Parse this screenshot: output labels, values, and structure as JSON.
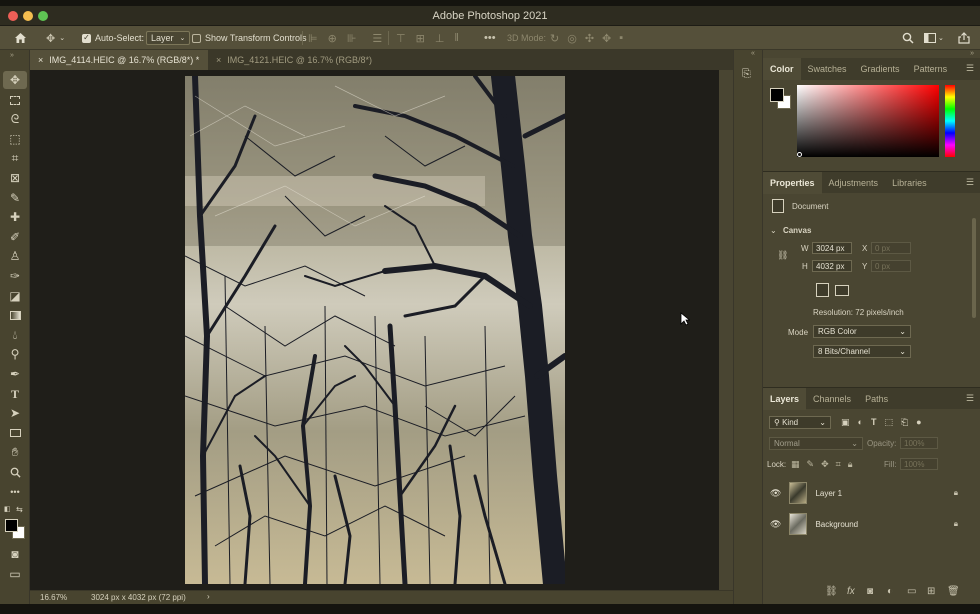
{
  "app": {
    "title": "Adobe Photoshop 2021"
  },
  "options_bar": {
    "auto_select_label": "Auto-Select:",
    "auto_select_checked": true,
    "auto_select_target": "Layer",
    "show_transform_label": "Show Transform Controls",
    "show_transform_checked": false,
    "mode_3d_label": "3D Mode:"
  },
  "tabs": [
    {
      "label": "IMG_4114.HEIC @ 16.7% (RGB/8*) *",
      "active": true
    },
    {
      "label": "IMG_4121.HEIC @ 16.7% (RGB/8*)",
      "active": false
    }
  ],
  "status_bar": {
    "zoom": "16.67%",
    "doc_info": "3024 px x 4032 px (72 ppi)"
  },
  "color_panel": {
    "tabs": [
      "Color",
      "Swatches",
      "Gradients",
      "Patterns"
    ],
    "active_tab": "Color",
    "hue_color": "#ff0000"
  },
  "properties_panel": {
    "tabs": [
      "Properties",
      "Adjustments",
      "Libraries"
    ],
    "active_tab": "Properties",
    "doc_label": "Document",
    "section_label": "Canvas",
    "w_label": "W",
    "w_value": "3024 px",
    "h_label": "H",
    "h_value": "4032 px",
    "x_label": "X",
    "x_placeholder": "0 px",
    "y_label": "Y",
    "y_placeholder": "0 px",
    "resolution": "Resolution: 72 pixels/inch",
    "mode_label": "Mode",
    "mode_value": "RGB Color",
    "depth_value": "8 Bits/Channel"
  },
  "layers_panel": {
    "tabs": [
      "Layers",
      "Channels",
      "Paths"
    ],
    "active_tab": "Layers",
    "filter_label": "Kind",
    "blend_mode": "Normal",
    "opacity_label": "Opacity:",
    "opacity_value": "100%",
    "lock_label": "Lock:",
    "fill_label": "Fill:",
    "fill_value": "100%",
    "layers": [
      {
        "name": "Layer 1",
        "visible": true,
        "locked": true
      },
      {
        "name": "Background",
        "visible": true,
        "locked": true
      }
    ]
  }
}
